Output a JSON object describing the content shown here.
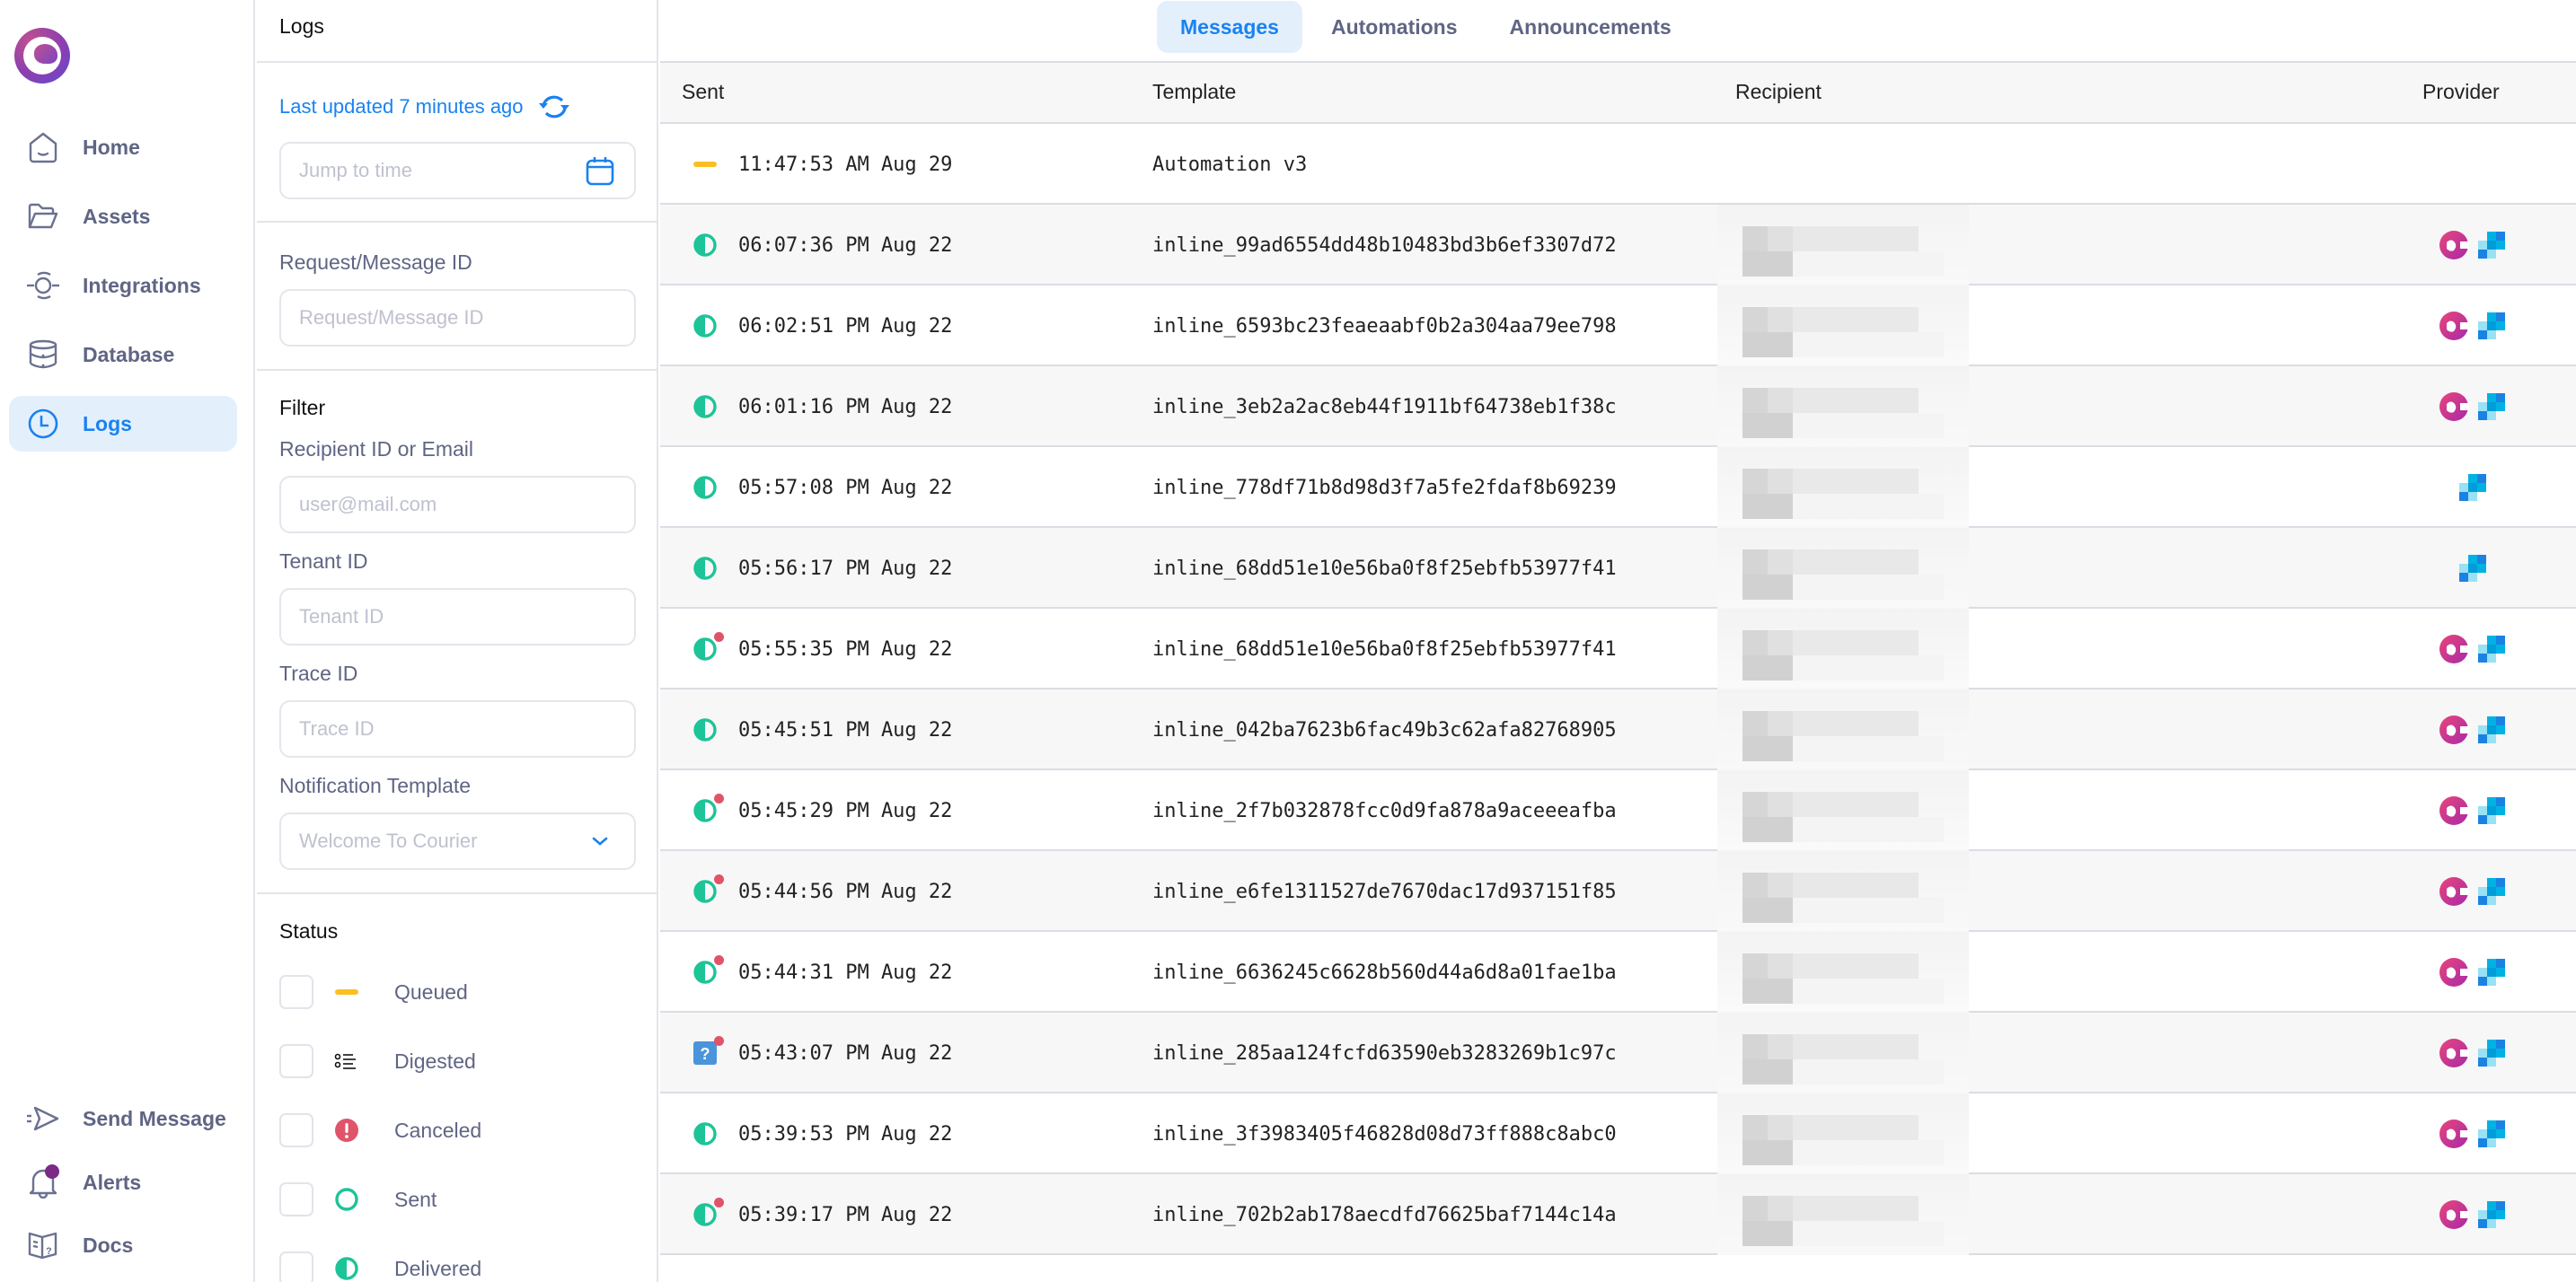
{
  "sidebar": {
    "items": [
      {
        "label": "Home",
        "icon": "home-icon",
        "active": false
      },
      {
        "label": "Assets",
        "icon": "folder-icon",
        "active": false
      },
      {
        "label": "Integrations",
        "icon": "integrations-icon",
        "active": false
      },
      {
        "label": "Database",
        "icon": "database-icon",
        "active": false
      },
      {
        "label": "Logs",
        "icon": "clock-icon",
        "active": true
      }
    ],
    "bottom_items": [
      {
        "label": "Send Message",
        "icon": "send-icon"
      },
      {
        "label": "Alerts",
        "icon": "bell-icon",
        "has_badge": true
      },
      {
        "label": "Docs",
        "icon": "docs-icon"
      }
    ]
  },
  "filter_panel": {
    "title": "Logs",
    "last_updated": "Last updated 7 minutes ago",
    "jump_to_time": {
      "placeholder": "Jump to time",
      "value": ""
    },
    "request_id": {
      "label": "Request/Message ID",
      "placeholder": "Request/Message ID",
      "value": ""
    },
    "filter_title": "Filter",
    "recipient": {
      "label": "Recipient ID or Email",
      "placeholder": "user@mail.com",
      "value": ""
    },
    "tenant": {
      "label": "Tenant ID",
      "placeholder": "Tenant ID",
      "value": ""
    },
    "trace": {
      "label": "Trace ID",
      "placeholder": "Trace ID",
      "value": ""
    },
    "template": {
      "label": "Notification Template",
      "placeholder": "Welcome To Courier",
      "value": ""
    },
    "status_title": "Status",
    "statuses": [
      {
        "label": "Queued",
        "icon": "queued-icon",
        "checked": false
      },
      {
        "label": "Digested",
        "icon": "digested-icon",
        "checked": false
      },
      {
        "label": "Canceled",
        "icon": "canceled-icon",
        "checked": false
      },
      {
        "label": "Sent",
        "icon": "sent-icon",
        "checked": false
      },
      {
        "label": "Delivered",
        "icon": "delivered-icon",
        "checked": false
      }
    ]
  },
  "tabs": [
    {
      "label": "Messages",
      "active": true
    },
    {
      "label": "Automations",
      "active": false
    },
    {
      "label": "Announcements",
      "active": false
    }
  ],
  "table": {
    "columns": [
      "Sent",
      "Template",
      "Recipient",
      "Provider"
    ],
    "rows": [
      {
        "status": "queued",
        "error": false,
        "sent": "11:47:53 AM Aug 29",
        "template": "Automation v3",
        "recipient": "",
        "providers": []
      },
      {
        "status": "delivered",
        "error": false,
        "sent": "06:07:36 PM Aug 22",
        "template": "inline_99ad6554dd48b10483bd3b6ef3307d72",
        "recipient": "[redacted]",
        "providers": [
          "courier",
          "sendgrid"
        ]
      },
      {
        "status": "delivered",
        "error": false,
        "sent": "06:02:51 PM Aug 22",
        "template": "inline_6593bc23feaeaabf0b2a304aa79ee798",
        "recipient": "[redacted]",
        "providers": [
          "courier",
          "sendgrid"
        ]
      },
      {
        "status": "delivered",
        "error": false,
        "sent": "06:01:16 PM Aug 22",
        "template": "inline_3eb2a2ac8eb44f1911bf64738eb1f38c",
        "recipient": "[redacted]",
        "providers": [
          "courier",
          "sendgrid"
        ]
      },
      {
        "status": "delivered",
        "error": false,
        "sent": "05:57:08 PM Aug 22",
        "template": "inline_778df71b8d98d3f7a5fe2fdaf8b69239",
        "recipient": "[redacted]",
        "providers": [
          "sendgrid"
        ]
      },
      {
        "status": "delivered",
        "error": false,
        "sent": "05:56:17 PM Aug 22",
        "template": "inline_68dd51e10e56ba0f8f25ebfb53977f41",
        "recipient": "[redacted]",
        "providers": [
          "sendgrid"
        ]
      },
      {
        "status": "delivered",
        "error": true,
        "sent": "05:55:35 PM Aug 22",
        "template": "inline_68dd51e10e56ba0f8f25ebfb53977f41",
        "recipient": "[redacted]",
        "providers": [
          "courier",
          "sendgrid"
        ]
      },
      {
        "status": "delivered",
        "error": false,
        "sent": "05:45:51 PM Aug 22",
        "template": "inline_042ba7623b6fac49b3c62afa82768905",
        "recipient": "[redacted]",
        "providers": [
          "courier",
          "sendgrid"
        ]
      },
      {
        "status": "delivered",
        "error": true,
        "sent": "05:45:29 PM Aug 22",
        "template": "inline_2f7b032878fcc0d9fa878a9aceeeafba",
        "recipient": "[redacted]",
        "providers": [
          "courier",
          "sendgrid"
        ]
      },
      {
        "status": "delivered",
        "error": true,
        "sent": "05:44:56 PM Aug 22",
        "template": "inline_e6fe1311527de7670dac17d937151f85",
        "recipient": "[redacted]",
        "providers": [
          "courier",
          "sendgrid"
        ]
      },
      {
        "status": "delivered",
        "error": true,
        "sent": "05:44:31 PM Aug 22",
        "template": "inline_6636245c6628b560d44a6d8a01fae1ba",
        "recipient": "[redacted]",
        "providers": [
          "courier",
          "sendgrid"
        ]
      },
      {
        "status": "unknown",
        "error": true,
        "sent": "05:43:07 PM Aug 22",
        "template": "inline_285aa124fcfd63590eb3283269b1c97c",
        "recipient": "[redacted]",
        "providers": [
          "courier",
          "sendgrid"
        ]
      },
      {
        "status": "delivered",
        "error": false,
        "sent": "05:39:53 PM Aug 22",
        "template": "inline_3f3983405f46828d08d73ff888c8abc0",
        "recipient": "[redacted]",
        "providers": [
          "courier",
          "sendgrid"
        ]
      },
      {
        "status": "delivered",
        "error": true,
        "sent": "05:39:17 PM Aug 22",
        "template": "inline_702b2ab178aecdfd76625baf7144c14a",
        "recipient": "[redacted]",
        "providers": [
          "courier",
          "sendgrid"
        ]
      }
    ]
  },
  "colors": {
    "accent": "#1a82f0",
    "active_bg": "#e3f0fc",
    "queued": "#fbbf24",
    "delivered": "#1dc497",
    "canceled": "#e0546a",
    "unknown": "#4a94dc",
    "alert_badge": "#7b2a85"
  }
}
